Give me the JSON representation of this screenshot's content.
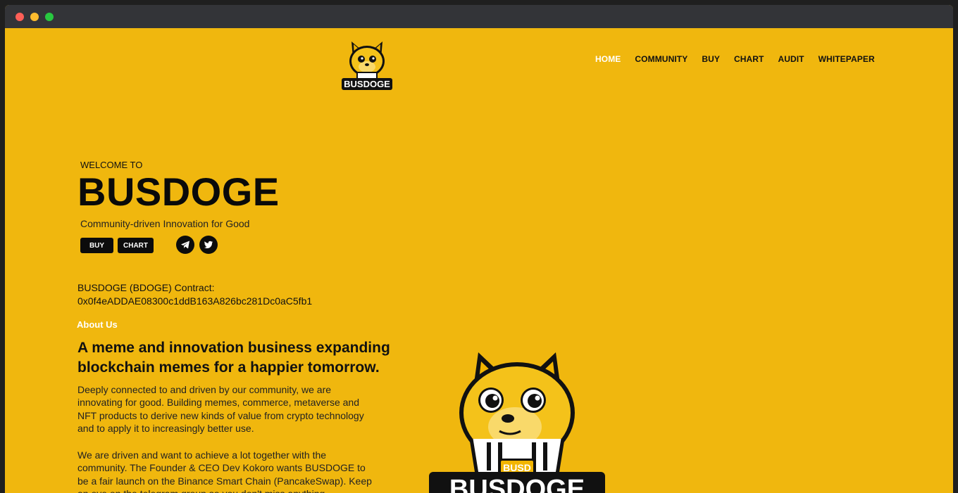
{
  "brand": {
    "logo_text": "BUSDOGE",
    "mascot_badge": "BUSD",
    "mascot_text": "BUSDOGE"
  },
  "nav": {
    "items": [
      {
        "label": "HOME"
      },
      {
        "label": "COMMUNITY"
      },
      {
        "label": "BUY"
      },
      {
        "label": "CHART"
      },
      {
        "label": "AUDIT"
      },
      {
        "label": "WHITEPAPER"
      }
    ],
    "active": "HOME"
  },
  "hero": {
    "welcome": "WELCOME TO",
    "title": "BUSDOGE",
    "tagline": "Community-driven Innovation for Good",
    "buy_label": "BUY",
    "chart_label": "CHART"
  },
  "social": {
    "telegram_icon": "telegram-icon",
    "twitter_icon": "twitter-icon"
  },
  "contract": {
    "label": "BUSDOGE (BDOGE) Contract:",
    "address": "0x0f4eADDAE08300c1ddB163A826bc281Dc0aC5fb1"
  },
  "about": {
    "label": "About Us",
    "title": "A meme and innovation business expanding blockchain memes for a happier tomorrow.",
    "p1": "Deeply connected to and driven by our community, we are innovating for good. Building memes, commerce, metaverse and NFT products to derive new kinds of value from crypto technology and to apply it to increasingly better use.",
    "p2": "We are driven and want to achieve a lot together with the community. The Founder & CEO Dev Kokoro wants BUSDOGE to be a fair launch on the Binance Smart Chain (PancakeSwap). Keep an eye on the telegram group so you don't miss anything."
  },
  "colors": {
    "background": "#f0b70e",
    "accent_active": "#ffffff",
    "button": "#0c0c0c"
  }
}
